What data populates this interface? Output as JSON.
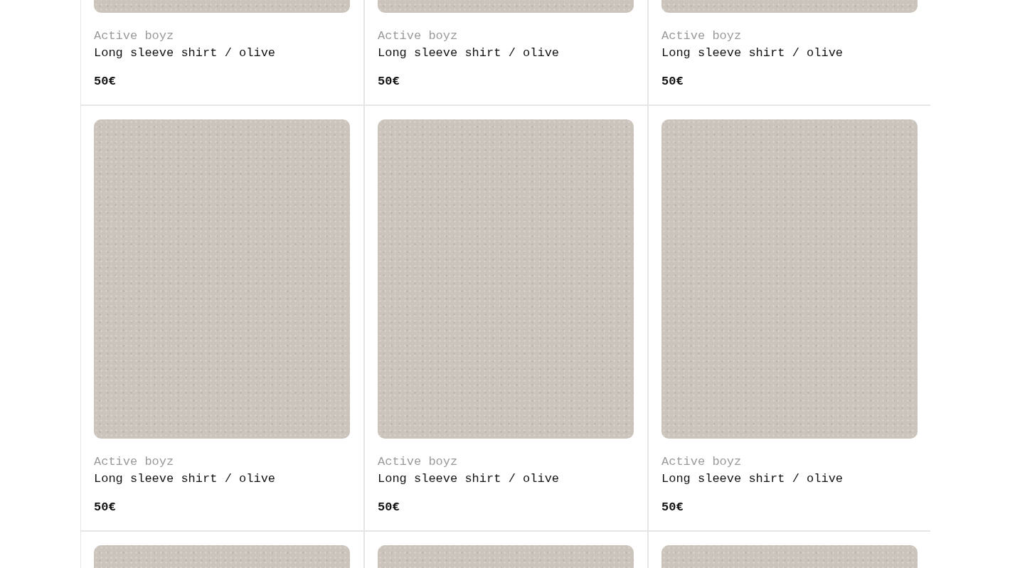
{
  "products": [
    {
      "kind": "full",
      "brand": "Active boyz",
      "name": "Long sleeve shirt / olive",
      "price": "50€"
    },
    {
      "kind": "full",
      "brand": "Active boyz",
      "name": "Long sleeve shirt / olive",
      "price": "50€"
    },
    {
      "kind": "full",
      "brand": "Active boyz",
      "name": "Long sleeve shirt / olive",
      "price": "50€"
    },
    {
      "kind": "full",
      "brand": "Active boyz",
      "name": "Long sleeve shirt / olive",
      "price": "50€"
    },
    {
      "kind": "full",
      "brand": "Active boyz",
      "name": "Long sleeve shirt / olive",
      "price": "50€"
    },
    {
      "kind": "full",
      "brand": "Active boyz",
      "name": "Long sleeve shirt / olive",
      "price": "50€"
    },
    {
      "kind": "photo"
    },
    {
      "kind": "photo"
    },
    {
      "kind": "photo"
    }
  ]
}
